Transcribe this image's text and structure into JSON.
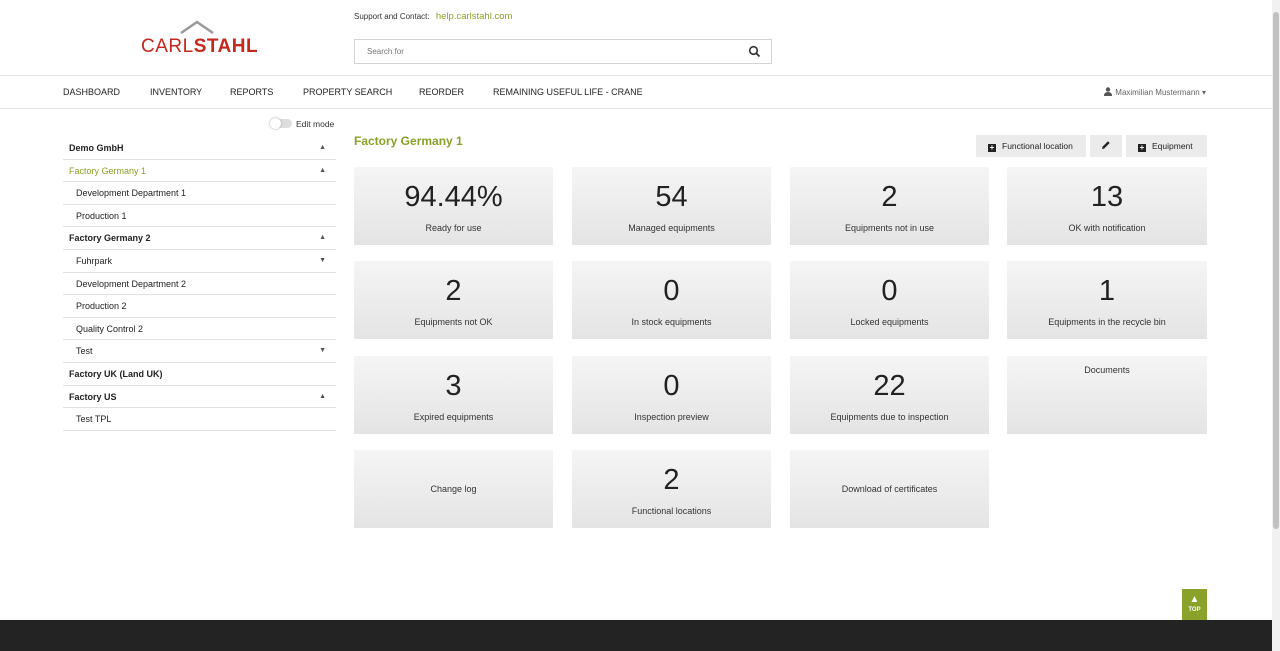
{
  "brand": {
    "logo_light": "CARL",
    "logo_bold": "STAHL",
    "accent": "#8aa12a",
    "logo_color": "#c4281c"
  },
  "support": {
    "label": "Support and Contact:",
    "link": "help.carlstahl.com"
  },
  "search": {
    "placeholder": "Search for",
    "icon": "search-icon"
  },
  "nav": {
    "items": [
      "DASHBOARD",
      "INVENTORY",
      "REPORTS",
      "PROPERTY SEARCH",
      "REORDER",
      "REMAINING USEFUL LIFE - CRANE"
    ],
    "user": "Maximilian Mustermann"
  },
  "sidebar": {
    "edit_mode": "Edit mode",
    "tree": [
      {
        "label": "Demo GmbH",
        "level": 0,
        "bold": true,
        "caret": "up"
      },
      {
        "label": "Factory Germany 1",
        "level": 0,
        "bold": false,
        "active": true,
        "caret": "up"
      },
      {
        "label": "Development Department 1",
        "level": 1
      },
      {
        "label": "Production 1",
        "level": 1
      },
      {
        "label": "Factory Germany 2",
        "level": 0,
        "bold": true,
        "caret": "up"
      },
      {
        "label": "Fuhrpark",
        "level": 1,
        "caret": "down"
      },
      {
        "label": "Development Department 2",
        "level": 1
      },
      {
        "label": "Production 2",
        "level": 1
      },
      {
        "label": "Quality Control 2",
        "level": 1
      },
      {
        "label": "Test",
        "level": 1,
        "caret": "down"
      },
      {
        "label": "Factory UK (Land UK)",
        "level": 0,
        "bold": true
      },
      {
        "label": "Factory US",
        "level": 0,
        "bold": true,
        "caret": "up"
      },
      {
        "label": "Test TPL",
        "level": 1
      }
    ]
  },
  "main": {
    "title": "Factory Germany 1",
    "actions": {
      "functional_location": "Functional location",
      "equipment": "Equipment"
    },
    "tiles": [
      {
        "value": "94.44%",
        "label": "Ready for use"
      },
      {
        "value": "54",
        "label": "Managed equipments"
      },
      {
        "value": "2",
        "label": "Equipments not in use"
      },
      {
        "value": "13",
        "label": "OK with notification"
      },
      {
        "value": "2",
        "label": "Equipments not OK"
      },
      {
        "value": "0",
        "label": "In stock equipments"
      },
      {
        "value": "0",
        "label": "Locked equipments"
      },
      {
        "value": "1",
        "label": "Equipments in the recycle bin"
      },
      {
        "value": "3",
        "label": "Expired equipments"
      },
      {
        "value": "0",
        "label": "Inspection preview"
      },
      {
        "value": "22",
        "label": "Equipments due to inspection"
      },
      {
        "value": "",
        "label": "Documents"
      },
      {
        "value": "",
        "label": "Change log"
      },
      {
        "value": "2",
        "label": "Functional locations"
      },
      {
        "value": "",
        "label": "Download of certificates"
      }
    ]
  },
  "footer": {
    "top_label": "TOP"
  }
}
